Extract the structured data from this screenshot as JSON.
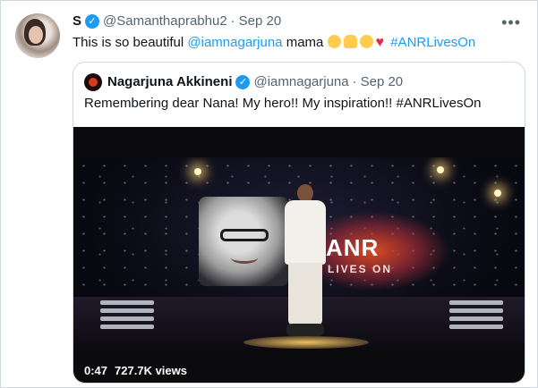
{
  "tweet": {
    "display_name": "S",
    "handle": "@Samanthaprabhu2",
    "time": "Sep 20",
    "text_before": "This is so beautiful ",
    "mention": "@iamnagarjuna",
    "text_after": " mama ",
    "hashtag": "#ANRLivesOn",
    "emojis": [
      "thinking-face-icon",
      "folded-hands-icon",
      "hugging-face-icon",
      "red-heart-icon"
    ],
    "more_icon": "more-icon"
  },
  "quoted": {
    "display_name": "Nagarjuna Akkineni",
    "handle": "@iamnagarjuna",
    "time": "Sep 20",
    "text": "Remembering dear Nana! My hero!! My inspiration!! #ANRLivesOn"
  },
  "video": {
    "stage_text_title": "ANR",
    "stage_text_sub": "LIVES ON",
    "duration": "0:47",
    "views": "727.7K views"
  },
  "colors": {
    "link": "#1d9bf0",
    "muted": "#536471",
    "verified": "#1d9bf0",
    "border": "#cfd9de"
  }
}
